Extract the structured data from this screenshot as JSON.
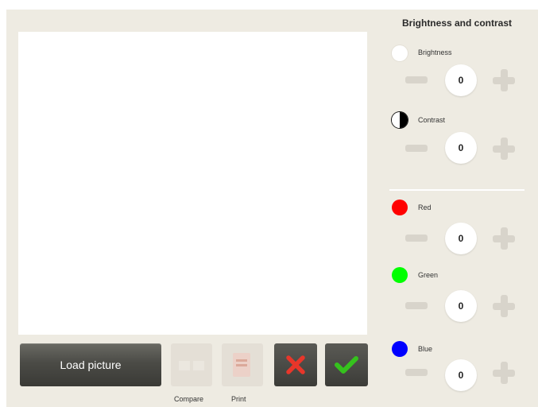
{
  "panel": {
    "title": "Brightness and contrast",
    "controls": [
      {
        "label": "Brightness",
        "value": "0",
        "indicator": "sun-indicator-icon"
      },
      {
        "label": "Contrast",
        "value": "0",
        "indicator": "contrast-indicator-icon"
      },
      {
        "label": "Red",
        "value": "0",
        "color": "#ff0000"
      },
      {
        "label": "Green",
        "value": "0",
        "color": "#00ff00"
      },
      {
        "label": "Blue",
        "value": "0",
        "color": "#0000ff"
      }
    ]
  },
  "buttons": {
    "load_label": "Load picture",
    "compare_label": "Compare",
    "print_label": "Print",
    "cancel_icon": "close-x-icon",
    "cancel_color": "#e8362a",
    "confirm_icon": "checkmark-icon",
    "confirm_color": "#35c21d"
  },
  "colors": {
    "background": "#eeebe2",
    "canvas": "#ffffff"
  }
}
